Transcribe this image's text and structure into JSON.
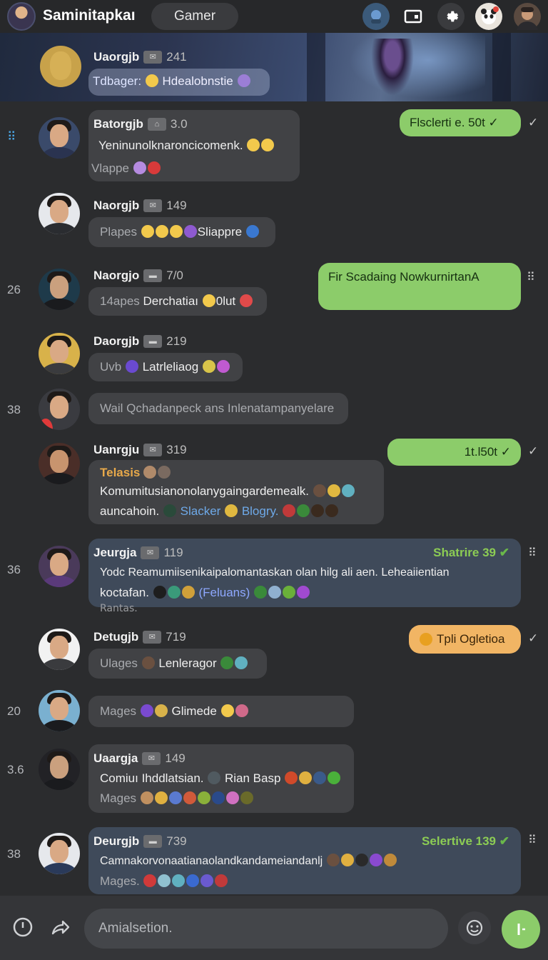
{
  "header": {
    "title": "Saminitapkaı",
    "mode": "Gamer"
  },
  "colors": {
    "accent_green": "#8ccc6a",
    "accent_orange": "#f1b564",
    "bubble": "#414245",
    "background": "#2b2c2e"
  },
  "messages": [
    {
      "name": "Uaorgjb",
      "count": "241",
      "line1_a": "Tdbager:",
      "line1_b": "Hdealobnstie",
      "side": ""
    },
    {
      "name": "Batorgjb",
      "count": "3.0",
      "line1": "Yeninunolknaroncicomenk.",
      "line2": "Vlappe"
    },
    {
      "name": "Naorgjb",
      "count": "149",
      "line1_a": "Plapes",
      "line1_b": "Sliappre"
    },
    {
      "name": "Naorgjo",
      "count": "7/0",
      "line1_a": "14apes",
      "line1_b": "Derchatiaı",
      "line1_c": "0lut",
      "side": "26"
    },
    {
      "name": "Daorgjb",
      "count": "219",
      "line1_a": "Uvb",
      "line1_b": "Latrleliaog"
    },
    {
      "text": "Wail Qchadanpeck ans Inlenatampanyelare",
      "side": "38"
    },
    {
      "name": "Uanrgju",
      "count": "319",
      "label": "Telasis",
      "line1": "Komumitusianonolanygaingardemealk.",
      "line2_a": "auncahoin.",
      "line2_b": "Slacker",
      "line2_c": "Blogry."
    },
    {
      "name": "Jeurgja",
      "count": "119",
      "right_label": "Shatrire 39",
      "line1": "Yodc Reamumiisenikaipalomantaskan olan hilg ali aen. Leheaiientian",
      "line2_a": "koctafan.",
      "line2_b": "(Feluans)",
      "line3": "Rantas.",
      "side": "36"
    },
    {
      "name": "Detugjb",
      "count": "719",
      "line1_a": "Ulages",
      "line1_b": "Lenleragor"
    },
    {
      "line1_a": "Mages",
      "line1_b": "Glimede",
      "side": "20"
    },
    {
      "name": "Uaargja",
      "count": "149",
      "line1_a": "Comiuı Ihddlatsian.",
      "line1_b": "Rian Basp",
      "line2": "Mages",
      "side": "3.6"
    },
    {
      "name": "Deurgjb",
      "count": "739",
      "right_label": "Selertive 139",
      "line1": "Camnakorvonaatianaolandkandameiandanlj",
      "line2": "Mages.",
      "side": "38"
    }
  ],
  "outgoing": [
    {
      "text": "Flsclerti e. 50t ✓",
      "status": "✓"
    },
    {
      "text": "Fir Scadaing NowkurnirtanA"
    },
    {
      "text": "1t.l50t ✓",
      "status": "✓"
    },
    {
      "text": "Tpli Ogletioa",
      "status": "✓"
    }
  ],
  "composer": {
    "placeholder": "Amialsetion."
  },
  "icons": [
    "user-avatar",
    "controller-icon",
    "screen-icon",
    "gear-icon",
    "panda-icon",
    "profile-avatar",
    "power-icon",
    "share-icon",
    "sticker-icon",
    "send-icon"
  ]
}
